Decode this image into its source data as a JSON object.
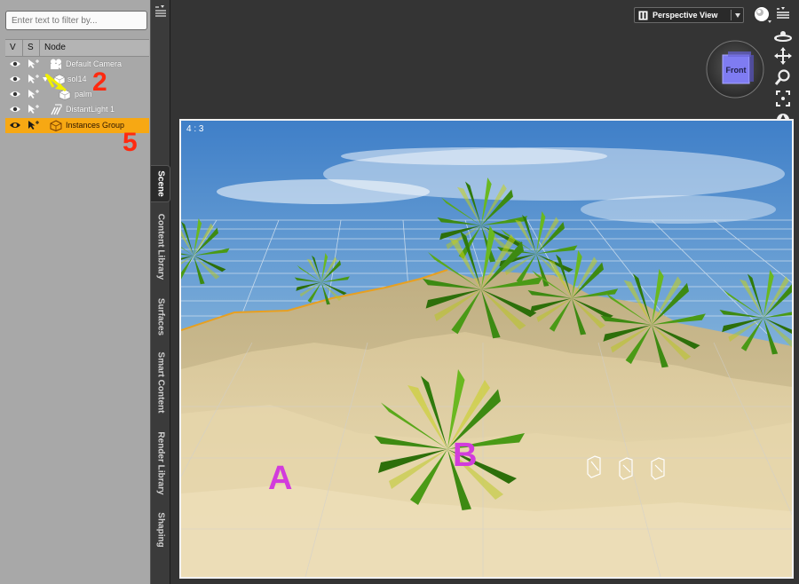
{
  "scene_panel": {
    "filter_placeholder": "Enter text to filter by...",
    "columns": {
      "v": "V",
      "s": "S",
      "node": "Node"
    },
    "nodes": [
      {
        "label": "Default Camera"
      },
      {
        "label": "sol14"
      },
      {
        "label": "palm"
      },
      {
        "label": "DistantLight 1"
      },
      {
        "label": "Instances Group"
      }
    ],
    "annotations": {
      "first": "2",
      "second": "5"
    }
  },
  "tabs": [
    "Scene",
    "Content Library",
    "Surfaces",
    "Smart Content",
    "Render Library",
    "Shaping"
  ],
  "viewport": {
    "camera_label": "Perspective View",
    "cube_label": "Front",
    "aspect_label": "4 : 3",
    "label_a": "A",
    "label_b": "B"
  },
  "colors": {
    "selection": "#f7a813",
    "annotation_red": "#ff2a10",
    "scene_label_magenta": "#d23cdc",
    "panel_gray": "#a8a8a8"
  }
}
